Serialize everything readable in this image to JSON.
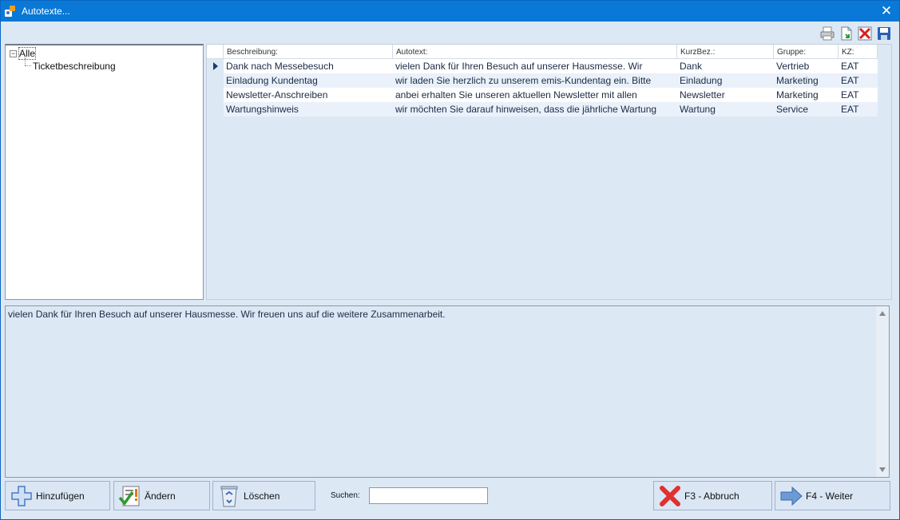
{
  "window": {
    "title": "Autotexte..."
  },
  "toolbar": {
    "icons": [
      "printer-icon",
      "export-document-icon",
      "delete-layout-icon",
      "save-icon"
    ]
  },
  "tree": {
    "root_label": "Alle",
    "root_toggle": "−",
    "children": [
      "Ticketbeschreibung"
    ]
  },
  "grid": {
    "columns": [
      "Beschreibung:",
      "Autotext:",
      "KurzBez.:",
      "Gruppe:",
      "KZ:"
    ],
    "rows": [
      {
        "beschreibung": "Dank nach Messebesuch",
        "autotext": "vielen Dank für Ihren Besuch auf unserer Hausmesse. Wir",
        "kurzbez": "Dank",
        "gruppe": "Vertrieb",
        "kz": "EAT"
      },
      {
        "beschreibung": "Einladung Kundentag",
        "autotext": "wir laden Sie herzlich zu unserem emis-Kundentag ein. Bitte",
        "kurzbez": "Einladung",
        "gruppe": "Marketing",
        "kz": "EAT"
      },
      {
        "beschreibung": "Newsletter-Anschreiben",
        "autotext": "anbei erhalten Sie unseren aktuellen Newsletter mit allen",
        "kurzbez": "Newsletter",
        "gruppe": "Marketing",
        "kz": "EAT"
      },
      {
        "beschreibung": "Wartungshinweis",
        "autotext": "wir möchten Sie darauf hinweisen, dass die jährliche Wartung",
        "kurzbez": "Wartung",
        "gruppe": "Service",
        "kz": "EAT"
      }
    ]
  },
  "detail": {
    "text": "vielen Dank für Ihren Besuch auf unserer Hausmesse. Wir freuen uns auf die weitere Zusammenarbeit."
  },
  "buttons": {
    "add_label": "Hinzufügen",
    "edit_label": "Ändern",
    "delete_label": "Löschen",
    "cancel_label": "F3 - Abbruch",
    "next_label": "F4 - Weiter"
  },
  "search": {
    "label": "Suchen:",
    "value": ""
  },
  "colors": {
    "titlebar": "#0a78d6",
    "background": "#dde8f5",
    "accent": "#1b3a6a"
  }
}
